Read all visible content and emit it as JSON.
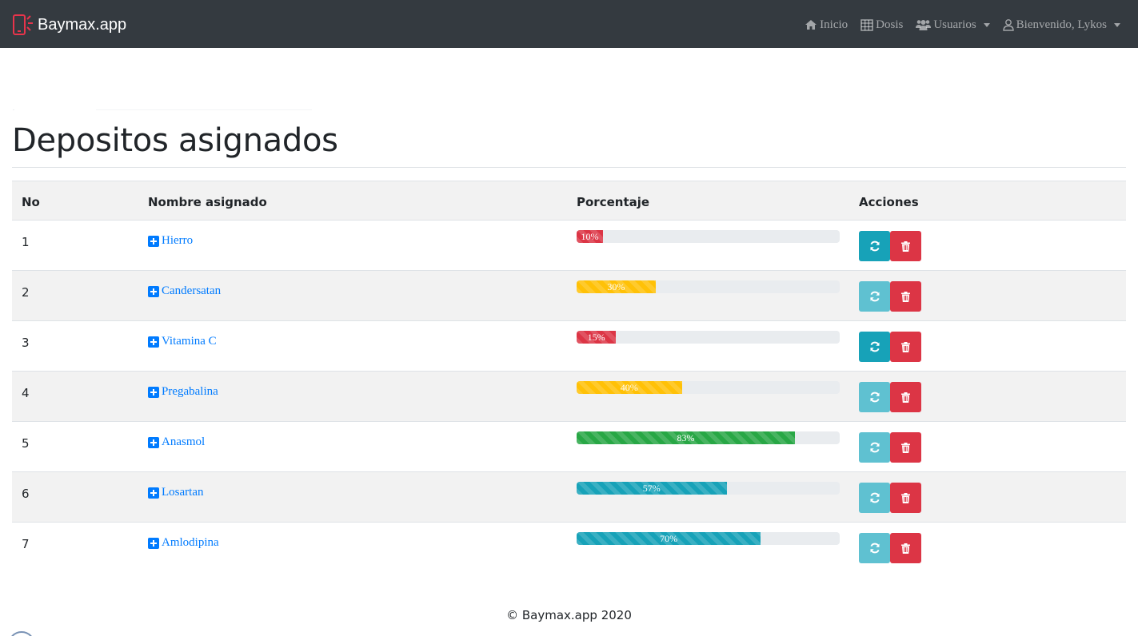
{
  "navbar": {
    "brand": "Baymax.app",
    "brand_icon": "phone-vibrate-icon",
    "brand_color": "#e8344b",
    "bg_color": "#343a40",
    "items": [
      {
        "label": "Inicio",
        "icon": "home-icon",
        "dropdown": false
      },
      {
        "label": "Dosis",
        "icon": "calendar-grid-icon",
        "dropdown": false
      },
      {
        "label": "Usuarios",
        "icon": "users-icon",
        "dropdown": true
      },
      {
        "label": "Bienvenido, Lykos",
        "icon": "user-icon",
        "dropdown": true
      }
    ]
  },
  "page": {
    "title": "Depositos asignados"
  },
  "table": {
    "headers": [
      "No",
      "Nombre asignado",
      "Porcentaje",
      "Acciones"
    ],
    "rows": [
      {
        "no": "1",
        "name": "Hierro",
        "percent": 10,
        "label": "10%",
        "color": "#dc3545",
        "sync_active": true
      },
      {
        "no": "2",
        "name": "Candersatan",
        "percent": 30,
        "label": "30%",
        "color": "#ffc107",
        "sync_active": false
      },
      {
        "no": "3",
        "name": "Vitamina C",
        "percent": 15,
        "label": "15%",
        "color": "#dc3545",
        "sync_active": true
      },
      {
        "no": "4",
        "name": "Pregabalina",
        "percent": 40,
        "label": "40%",
        "color": "#ffc107",
        "sync_active": false
      },
      {
        "no": "5",
        "name": "Anasmol",
        "percent": 83,
        "label": "83%",
        "color": "#28a745",
        "sync_active": false
      },
      {
        "no": "6",
        "name": "Losartan",
        "percent": 57,
        "label": "57%",
        "color": "#17a2b8",
        "sync_active": false
      },
      {
        "no": "7",
        "name": "Amlodipina",
        "percent": 70,
        "label": "70%",
        "color": "#17a2b8",
        "sync_active": false
      }
    ]
  },
  "footer": {
    "text": "© Baymax.app 2020"
  }
}
